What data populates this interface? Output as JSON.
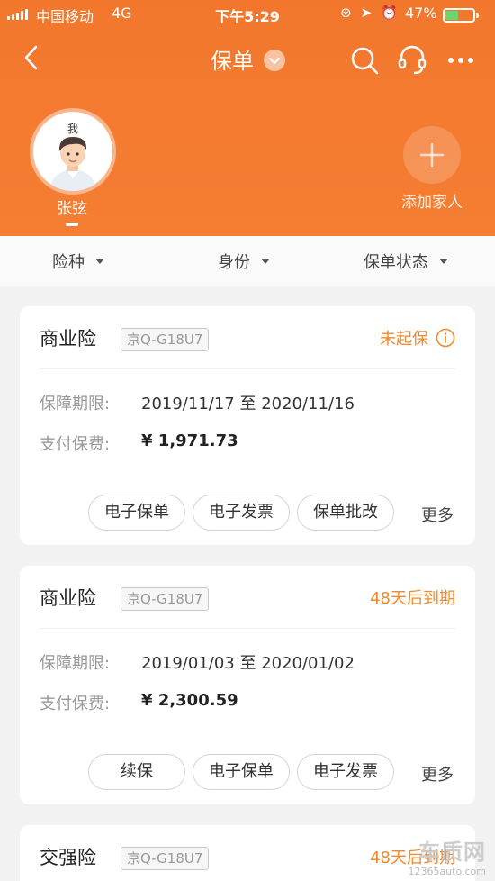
{
  "status_bar": {
    "carrier": "中国移动",
    "network": "4G",
    "time": "下午5:29",
    "battery": "47%",
    "battery_level": 0.47
  },
  "nav": {
    "title": "保单"
  },
  "members": [
    {
      "badge": "我",
      "name": "张弦"
    }
  ],
  "add_member": {
    "label": "添加家人"
  },
  "filters": [
    {
      "label": "险种"
    },
    {
      "label": "身份"
    },
    {
      "label": "保单状态"
    }
  ],
  "policies": [
    {
      "type": "商业险",
      "plate": "京Q-G18U7",
      "status": "未起保",
      "period_label": "保障期限:",
      "period": "2019/11/17 至 2020/11/16",
      "pay_label": "支付保费:",
      "pay": "¥ 1,971.73",
      "actions": [
        "电子保单",
        "电子发票",
        "保单批改"
      ],
      "more": "更多"
    },
    {
      "type": "商业险",
      "plate": "京Q-G18U7",
      "status": "48天后到期",
      "period_label": "保障期限:",
      "period": "2019/01/03 至 2020/01/02",
      "pay_label": "支付保费:",
      "pay": "¥ 2,300.59",
      "actions": [
        "续保",
        "电子保单",
        "电子发票"
      ],
      "more": "更多"
    },
    {
      "type": "交强险",
      "plate": "京Q-G18U7",
      "status": "48天后到期"
    }
  ],
  "watermark": {
    "text": "车质网",
    "url": "12365auto.com"
  },
  "colors": {
    "brand": "#f57e33",
    "status": "#f08a2c"
  }
}
